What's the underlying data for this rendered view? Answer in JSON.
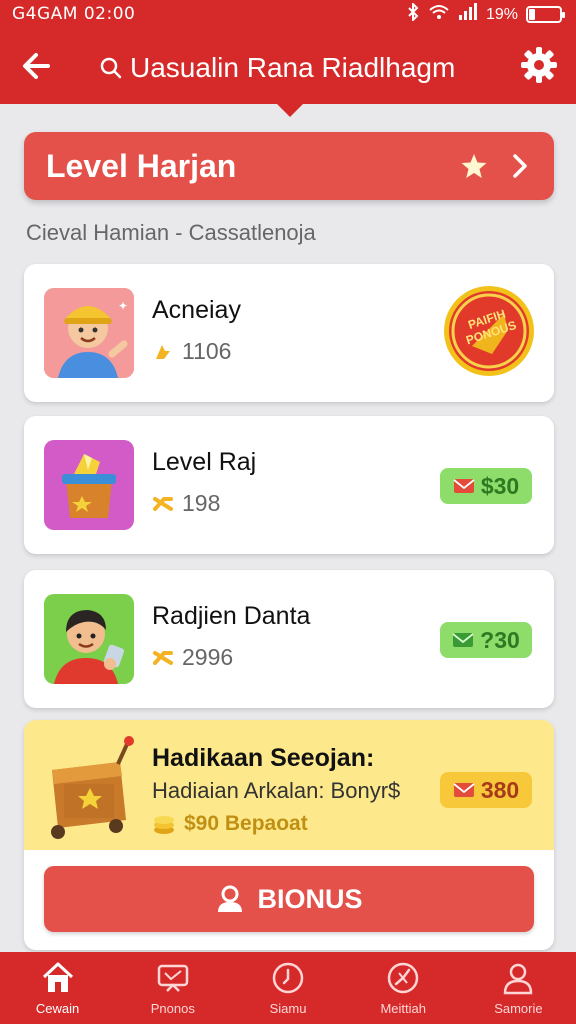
{
  "status_bar": {
    "time": "G4GAM 02:00",
    "battery_percent": "19%",
    "battery_level": 0.19
  },
  "header": {
    "search_text": "Uasualin Rana Riadlhagm"
  },
  "level_banner": {
    "title": "Level Harjan"
  },
  "subtitle": "Cieval Hamian - Cassatlenoja",
  "cards": [
    {
      "name": "Acneiay",
      "points": "1106",
      "reward_badge": "PAIFIH PONOUS"
    },
    {
      "name": "Level Raj",
      "points": "198",
      "reward": "$30"
    },
    {
      "name": "Radjien Danta",
      "points": "2996",
      "reward": "?30"
    }
  ],
  "special": {
    "title": "Hadikaan Seeojan:",
    "description": "Hadiaian Arkalan: Bonyr$",
    "bonus_text": "$90 Bepaoat",
    "reward": "380",
    "button_label": "BIONUS"
  },
  "bottom_nav": [
    {
      "label": "Cewain",
      "icon": "home-icon",
      "active": true
    },
    {
      "label": "Pnonos",
      "icon": "tv-icon",
      "active": false
    },
    {
      "label": "Siamu",
      "icon": "clock-icon",
      "active": false
    },
    {
      "label": "Meittiah",
      "icon": "timer-icon",
      "active": false
    },
    {
      "label": "Samorie",
      "icon": "user-icon",
      "active": false
    }
  ],
  "colors": {
    "primary_red": "#d62a2a",
    "banner_red": "#e3514a",
    "reward_green": "#8edc6a",
    "reward_gold": "#f7c93a",
    "special_yellow": "#fde98c"
  }
}
